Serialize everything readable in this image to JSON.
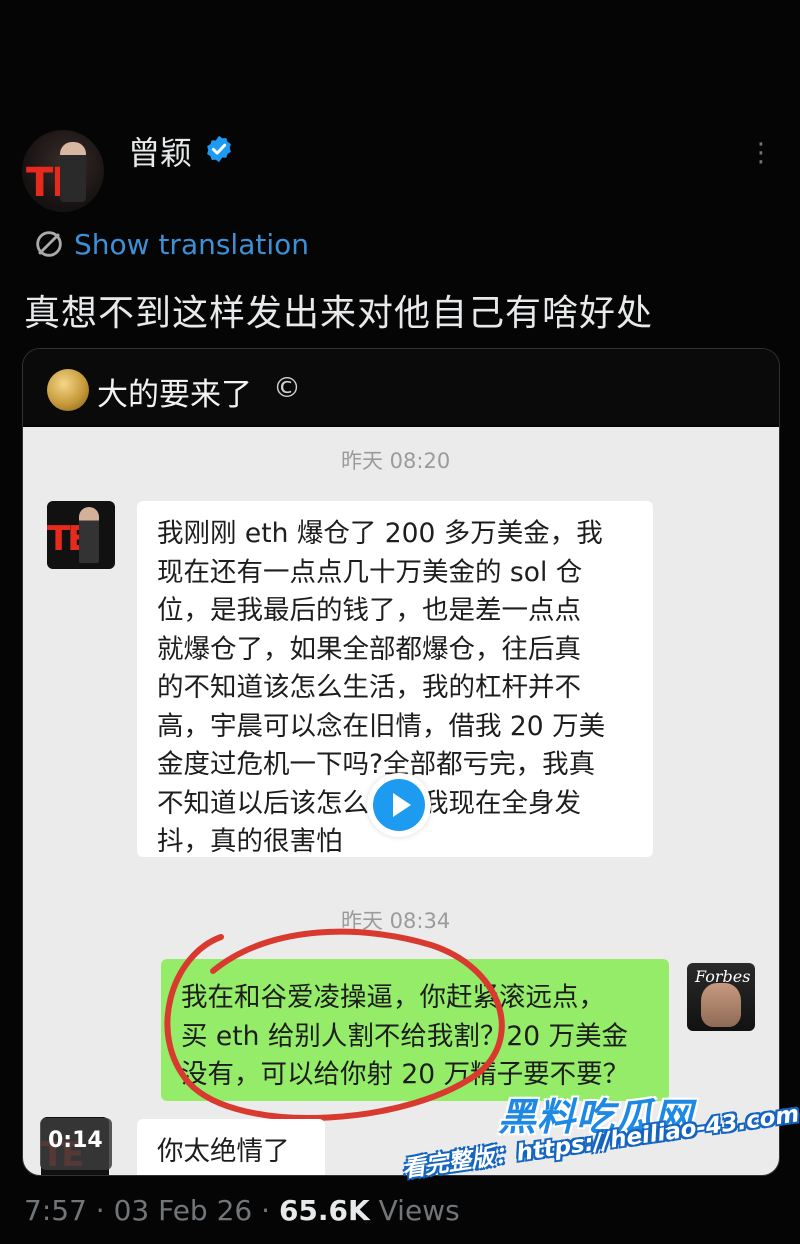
{
  "tweet": {
    "author_name": "曾颖",
    "translate_label": "Show translation",
    "text": "真想不到这样发出来对他自己有啥好处",
    "footer": {
      "time": "7:57",
      "separator": " · ",
      "date": "03 Feb 26",
      "views_count": "65.6K",
      "views_label": " Views"
    }
  },
  "embed": {
    "group_title": "大的要来了",
    "group_suffix": "©",
    "video_duration": "0:14",
    "messages": [
      {
        "type": "timestamp",
        "text": "昨天 08:20"
      },
      {
        "type": "received",
        "lines": [
          "我刚刚 eth 爆仓了 200 多万美金，我",
          "现在还有一点点几十万美金的 sol 仓",
          "位，是我最后的钱了，也是差一点点",
          "就爆仓了，如果全部都爆仓，往后真",
          "的不知道该怎么生活，我的杠杆并不",
          "高，宇晨可以念在旧情，借我 20 万美",
          "金度过危机一下吗?全部都亏完，我真",
          "不知道以后该怎么办，我现在全身发",
          "抖，真的很害怕"
        ]
      },
      {
        "type": "timestamp",
        "text": "昨天 08:34"
      },
      {
        "type": "sent",
        "lines": [
          "我在和谷爱凌操逼，你赶紧滚远点，",
          "买 eth 给别人割不给我割？20 万美金",
          "没有，可以给你射 20 万精子要不要？"
        ]
      },
      {
        "type": "received",
        "lines": [
          "你太绝情了"
        ]
      }
    ],
    "forbes_logo": "Forbes"
  },
  "watermark": {
    "title": "黑料吃瓜网",
    "url": "看完整版：https://heiliao-43.com"
  },
  "colors": {
    "background": "#050505",
    "link_blue": "#3d8fd6",
    "verified_blue": "#1d9bf0",
    "bubble_green": "#95ec69",
    "chat_bg": "#ebebeb",
    "annotation_red": "#d93a2f"
  }
}
